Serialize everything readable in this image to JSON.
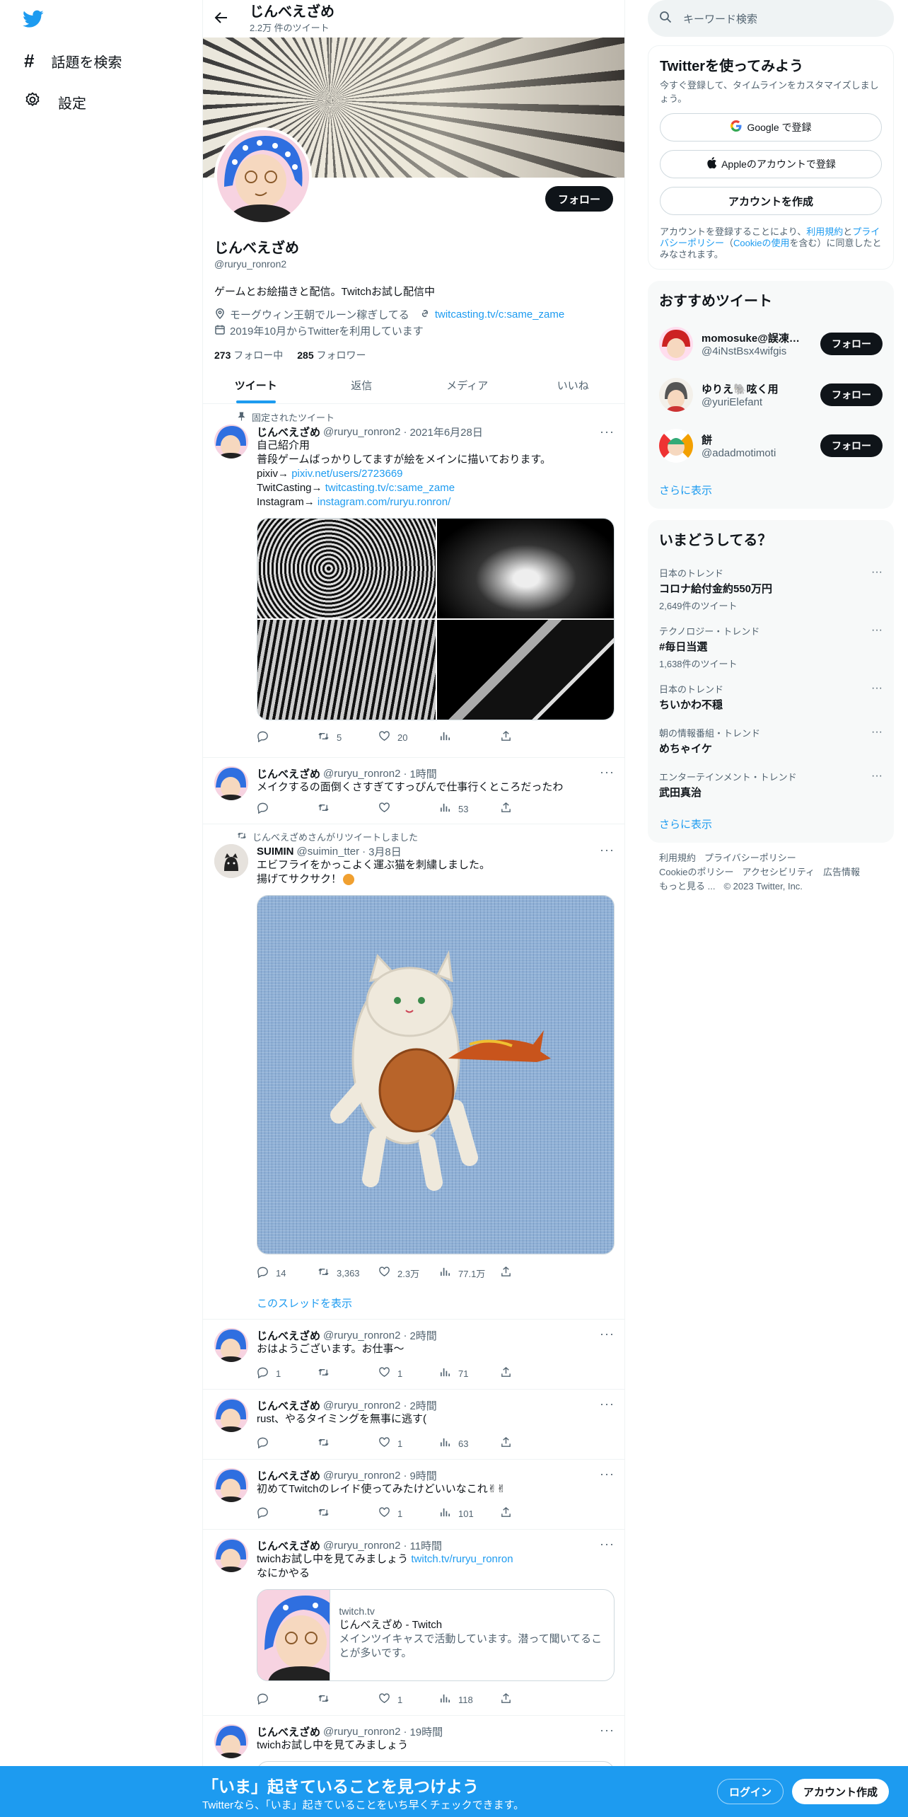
{
  "nav": {
    "logo": "twitter-bird-icon",
    "explore": "話題を検索",
    "settings": "設定"
  },
  "header": {
    "title": "じんべえざめ",
    "tweet_count": "2.2万 件のツイート"
  },
  "profile": {
    "name": "じんべえざめ",
    "handle": "@ruryu_ronron2",
    "follow_label": "フォロー",
    "bio": "ゲームとお絵描きと配信。Twitchお試し配信中",
    "location": "モーグウィン王朝でルーン稼ぎしてる",
    "website": "twitcasting.tv/c:same_zame",
    "joined": "2019年10月からTwitterを利用しています",
    "following_count": "273",
    "following_label": "フォロー中",
    "followers_count": "285",
    "followers_label": "フォロワー"
  },
  "tabs": [
    "ツイート",
    "返信",
    "メディア",
    "いいね"
  ],
  "tweets": [
    {
      "context": "固定されたツイート",
      "name": "じんべえざめ",
      "handle": "@ruryu_ronron2",
      "time": "2021年6月28日",
      "lines": [
        "自己紹介用",
        "普段ゲームばっかりしてますが絵をメインに描いております。"
      ],
      "pixiv_label": "pixiv→",
      "pixiv_link": "pixiv.net/users/2723669",
      "twitcasting_label": "TwitCasting→",
      "twitcasting_link": "twitcasting.tv/c:same_zame",
      "instagram_label": "Instagram→",
      "instagram_link": "instagram.com/ruryu.ronron/",
      "reply": "",
      "retweet": "5",
      "like": "20",
      "views": ""
    },
    {
      "name": "じんべえざめ",
      "handle": "@ruryu_ronron2",
      "time": "1時間",
      "text": "メイクするの面倒くさすぎてすっぴんで仕事行くところだったわ",
      "reply": "",
      "retweet": "",
      "like": "",
      "views": "53"
    },
    {
      "context": "じんべえざめさんがリツイートしました",
      "name": "SUIMIN",
      "handle": "@suimin_tter",
      "time": "3月8日",
      "lines": [
        "エビフライをかっこよく運ぶ猫を刺繍しました。",
        "揚げてサクサク！"
      ],
      "reply": "14",
      "retweet": "3,363",
      "like": "2.3万",
      "views": "77.1万",
      "thread_link": "このスレッドを表示"
    },
    {
      "name": "じんべえざめ",
      "handle": "@ruryu_ronron2",
      "time": "2時間",
      "text": "おはようございます。お仕事〜",
      "reply": "1",
      "retweet": "",
      "like": "1",
      "views": "71"
    },
    {
      "name": "じんべえざめ",
      "handle": "@ruryu_ronron2",
      "time": "2時間",
      "text": "rust、やるタイミングを無事に逃す(",
      "reply": "",
      "retweet": "",
      "like": "1",
      "views": "63"
    },
    {
      "name": "じんべえざめ",
      "handle": "@ruryu_ronron2",
      "time": "9時間",
      "text": "初めてTwitchのレイド使ってみたけどいいなこれ✌✌",
      "reply": "",
      "retweet": "",
      "like": "1",
      "views": "101"
    },
    {
      "name": "じんべえざめ",
      "handle": "@ruryu_ronron2",
      "time": "11時間",
      "text": "twichお試し中を見てみましょう",
      "link": "twitch.tv/ruryu_ronron",
      "line2": "なにかやる",
      "card_domain": "twitch.tv",
      "card_title": "じんべえざめ - Twitch",
      "card_desc": "メインツイキャスで活動しています。潜って聞いてることが多いです。",
      "reply": "",
      "retweet": "",
      "like": "1",
      "views": "118"
    },
    {
      "name": "じんべえざめ",
      "handle": "@ruryu_ronron2",
      "time": "19時間",
      "text": "twichお試し中を見てみましょう"
    }
  ],
  "right": {
    "search_placeholder": "キーワード検索",
    "signup": {
      "title": "Twitterを使ってみよう",
      "desc": "今すぐ登録して、タイムラインをカスタマイズしましょう。",
      "google": "Google で登録",
      "apple": "Appleのアカウントで登録",
      "create": "アカウントを作成",
      "legal_prefix": "アカウントを登録することにより、",
      "terms": "利用規約",
      "and": "と",
      "privacy": "プライバシーポリシー",
      "cookie_open": "（",
      "cookie": "Cookieの使用",
      "legal_suffix": "を含む）に同意したとみなされます。"
    },
    "recommended": {
      "title": "おすすめツイート",
      "users": [
        {
          "name": "momosuke@誤凍結...",
          "handle": "@4iNstBsx4wifgis",
          "button": "フォロー"
        },
        {
          "name": "ゆりえ🐘呟く用",
          "handle": "@yuriElefant",
          "button": "フォロー"
        },
        {
          "name": "餅",
          "handle": "@adadmotimoti",
          "button": "フォロー"
        }
      ],
      "show_more": "さらに表示"
    },
    "trends": {
      "title": "いまどうしてる？",
      "items": [
        {
          "category": "日本のトレンド",
          "topic": "コロナ給付金約550万円",
          "count": "2,649件のツイート"
        },
        {
          "category": "テクノロジー・トレンド",
          "topic": "#毎日当選",
          "count": "1,638件のツイート"
        },
        {
          "category": "日本のトレンド",
          "topic": "ちいかわ不穏",
          "count": ""
        },
        {
          "category": "朝の情報番組・トレンド",
          "topic": "めちゃイケ",
          "count": ""
        },
        {
          "category": "エンターテインメント・トレンド",
          "topic": "武田真治",
          "count": ""
        }
      ],
      "show_more": "さらに表示"
    },
    "footer": {
      "terms": "利用規約",
      "privacy": "プライバシーポリシー",
      "cookie": "Cookieのポリシー",
      "access": "アクセシビリティ",
      "ads": "広告情報",
      "more": "もっと見る ...",
      "copyright": "© 2023 Twitter, Inc."
    }
  },
  "bottombar": {
    "headline": "「いま」起きていることを見つけよう",
    "sub": "Twitterなら、「いま」起きていることをいち早くチェックできます。",
    "login": "ログイン",
    "signup": "アカウント作成"
  }
}
